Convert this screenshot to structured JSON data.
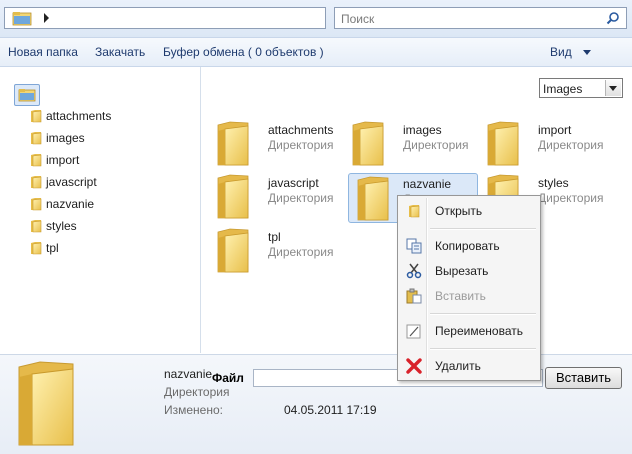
{
  "search": {
    "placeholder": "Поиск"
  },
  "toolbar": {
    "new_folder": "Новая папка",
    "upload": "Закачать",
    "clipboard": "Буфер обмена ( 0 объектов )",
    "view": "Вид"
  },
  "tree": {
    "items": [
      {
        "label": "attachments"
      },
      {
        "label": "images"
      },
      {
        "label": "import"
      },
      {
        "label": "javascript"
      },
      {
        "label": "nazvanie"
      },
      {
        "label": "styles"
      },
      {
        "label": "tpl"
      }
    ]
  },
  "filter": {
    "selected": "Images"
  },
  "files": [
    {
      "name": "attachments",
      "type": "Директория"
    },
    {
      "name": "images",
      "type": "Директория"
    },
    {
      "name": "import",
      "type": "Директория"
    },
    {
      "name": "javascript",
      "type": "Директория"
    },
    {
      "name": "nazvanie",
      "type": "Директория",
      "selected": true
    },
    {
      "name": "styles",
      "type": "Директория"
    },
    {
      "name": "tpl",
      "type": "Директория"
    }
  ],
  "details": {
    "name": "nazvanie",
    "type": "Директория",
    "modified_label": "Изменено:",
    "modified_value": "04.05.2011 17:19",
    "file_label": "Файл",
    "upload_button": "Вставить"
  },
  "context_menu": {
    "open": "Открыть",
    "copy": "Копировать",
    "cut": "Вырезать",
    "paste": "Вставить",
    "rename": "Переименовать",
    "delete": "Удалить"
  },
  "colors": {
    "folder": "#f2d675",
    "accent": "#1e3a6e",
    "selection": "#dbe8f8"
  }
}
